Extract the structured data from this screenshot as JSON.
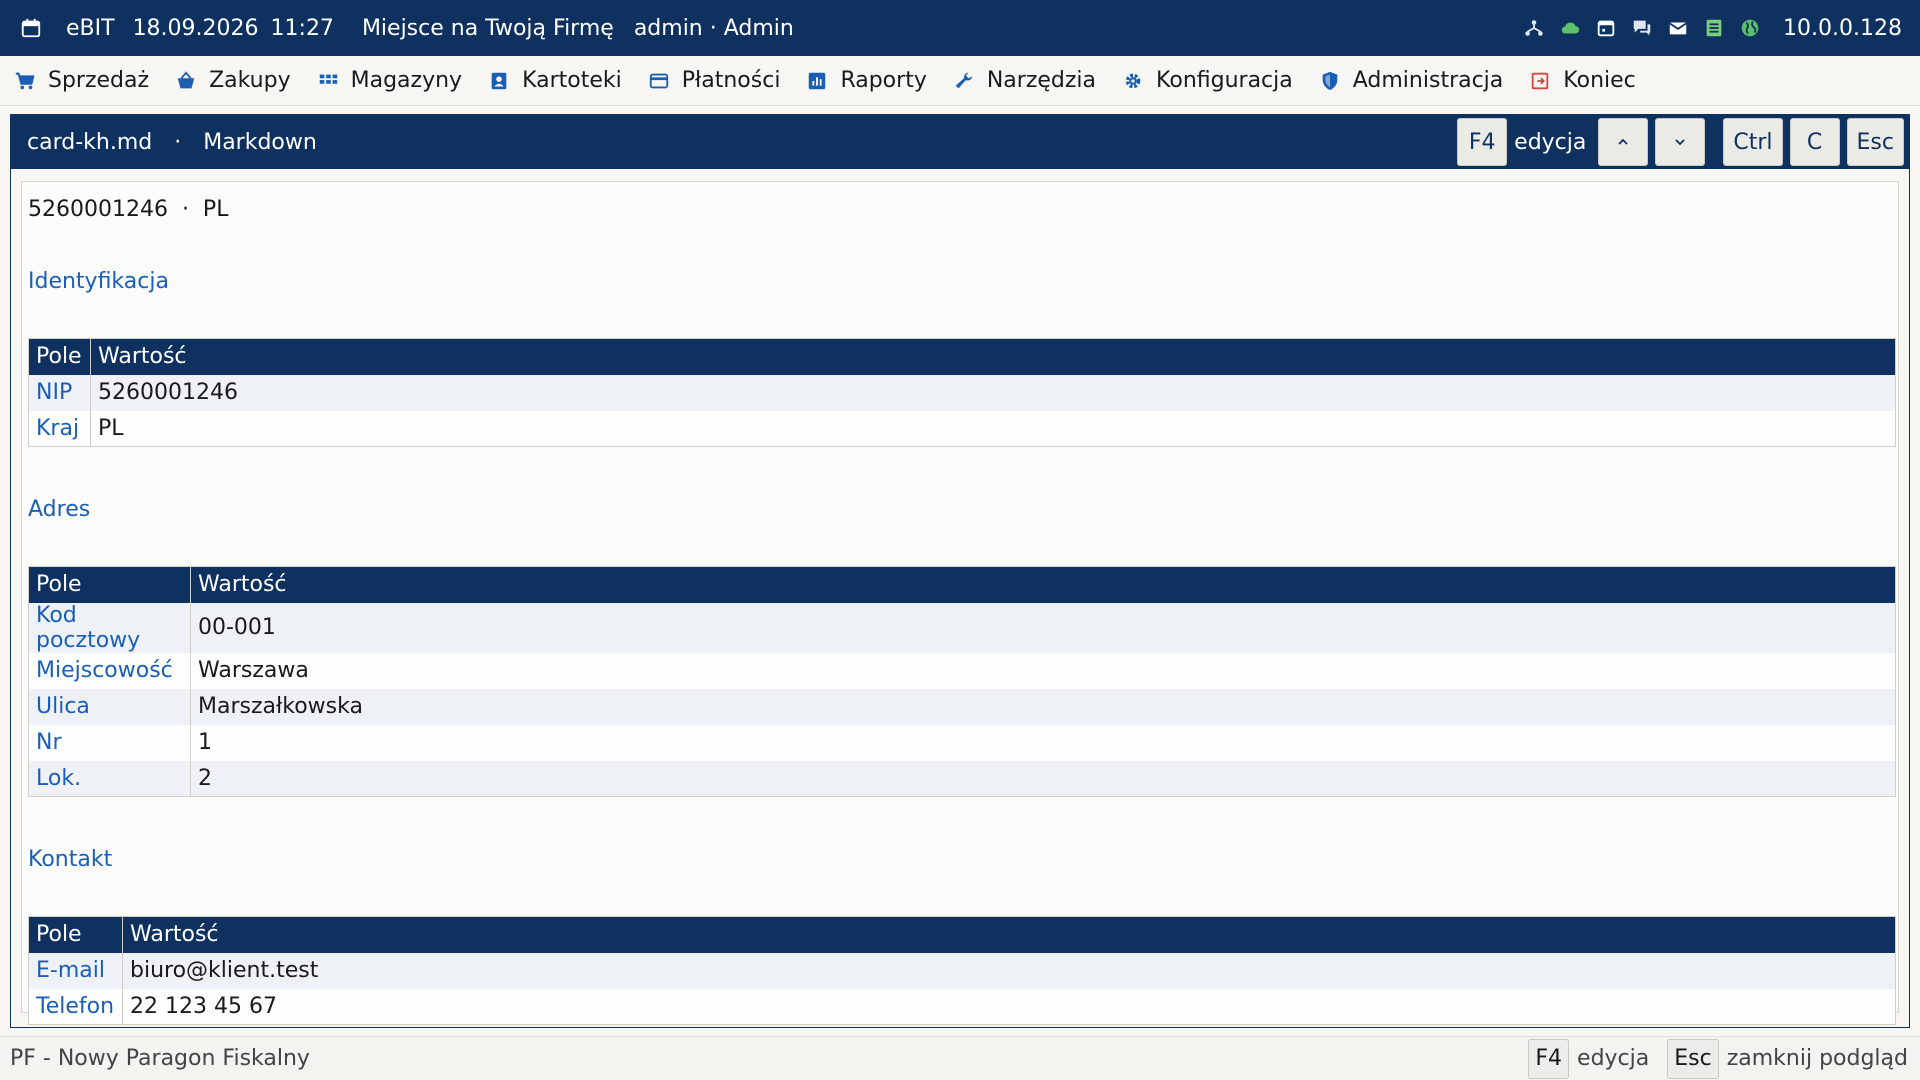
{
  "titlebar": {
    "app": "eBIT",
    "date": "18.09.2026",
    "time": "11:27",
    "company": "Miejsce na Twoją Firmę",
    "user": "admin · Admin",
    "ip": "10.0.0.128",
    "status_icons": [
      "network-icon",
      "cloud-icon",
      "calendar-icon",
      "chat-icon",
      "mail-icon",
      "list-icon",
      "globe-icon"
    ]
  },
  "menu": {
    "items": [
      {
        "label": "Sprzedaż",
        "icon": "cart-icon"
      },
      {
        "label": "Zakupy",
        "icon": "basket-icon"
      },
      {
        "label": "Magazyny",
        "icon": "grid-icon"
      },
      {
        "label": "Kartoteki",
        "icon": "contacts-icon"
      },
      {
        "label": "Płatności",
        "icon": "card-icon"
      },
      {
        "label": "Raporty",
        "icon": "chart-icon"
      },
      {
        "label": "Narzędzia",
        "icon": "wrench-icon"
      },
      {
        "label": "Konfiguracja",
        "icon": "gear-icon"
      },
      {
        "label": "Administracja",
        "icon": "shield-icon"
      },
      {
        "label": "Koniec",
        "icon": "exit-icon"
      }
    ]
  },
  "panel": {
    "filename": "card-kh.md",
    "separator": "·",
    "mode": "Markdown",
    "controls": {
      "f4": "F4",
      "edit_label": "edycja",
      "ctrl": "Ctrl",
      "c": "C",
      "esc": "Esc"
    }
  },
  "document": {
    "id_line": "5260001246  ·  PL",
    "col_field": "Pole",
    "col_value": "Wartość",
    "sections": [
      {
        "title": "Identyfikacja",
        "rows": [
          {
            "field": "NIP",
            "value": "5260001246"
          },
          {
            "field": "Kraj",
            "value": "PL"
          }
        ]
      },
      {
        "title": "Adres",
        "rows": [
          {
            "field": "Kod pocztowy",
            "value": "00-001"
          },
          {
            "field": "Miejscowość",
            "value": "Warszawa"
          },
          {
            "field": "Ulica",
            "value": "Marszałkowska"
          },
          {
            "field": "Nr",
            "value": "1"
          },
          {
            "field": "Lok.",
            "value": "2"
          }
        ]
      },
      {
        "title": "Kontakt",
        "rows": [
          {
            "field": "E-mail",
            "value": "biuro@klient.test"
          },
          {
            "field": "Telefon",
            "value": "22 123 45 67"
          }
        ]
      }
    ]
  },
  "statusbar": {
    "left_text": "PF - Nowy Paragon Fiskalny",
    "f4": "F4",
    "f4_label": "edycja",
    "esc": "Esc",
    "esc_label": "zamknij podgląd"
  },
  "colors": {
    "navy": "#0e3160",
    "accent_blue": "#1a5fb4",
    "background": "#f7f6f2"
  }
}
